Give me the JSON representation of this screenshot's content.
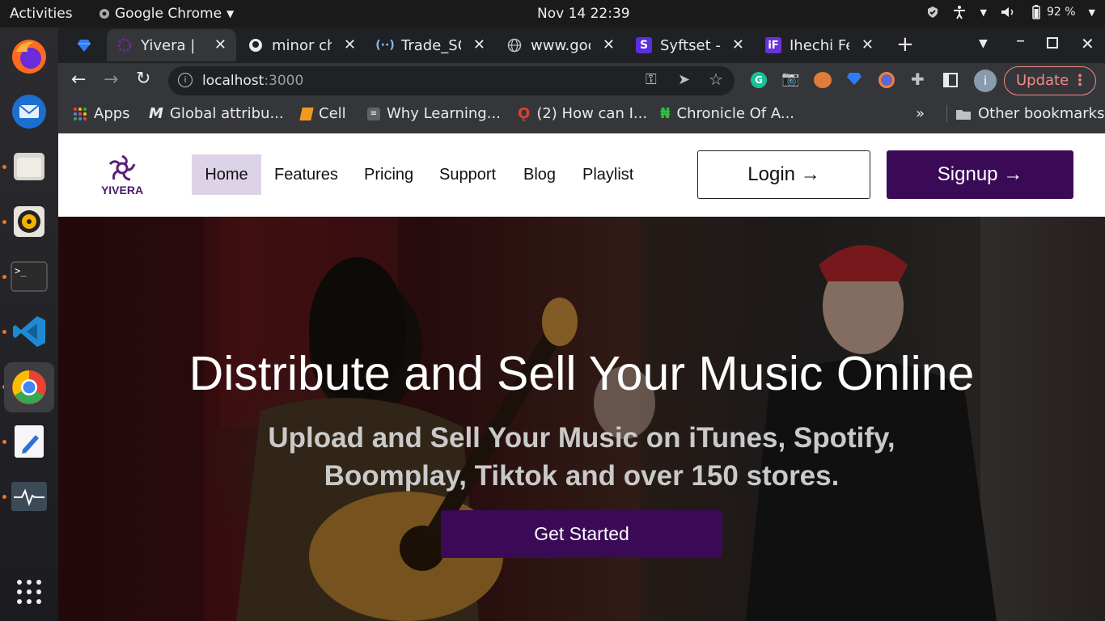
{
  "system": {
    "activities": "Activities",
    "app_name": "Google Chrome",
    "clock": "Nov 14  22:39",
    "battery": "92 %"
  },
  "tabs": [
    {
      "title": "",
      "icon": "gem-icon"
    },
    {
      "title": "Yivera | M",
      "icon": "yivera-icon"
    },
    {
      "title": "minor cha",
      "icon": "github-icon"
    },
    {
      "title": "Trade_SC",
      "icon": "code-icon"
    },
    {
      "title": "www.goo",
      "icon": "globe-icon"
    },
    {
      "title": "Syftset - F",
      "icon": "s-icon"
    },
    {
      "title": "Ihechi Fes",
      "icon": "if-icon"
    }
  ],
  "toolbar": {
    "url_host": "localhost",
    "url_port": ":3000",
    "update_label": "Update"
  },
  "bookmarks": {
    "items": [
      "Apps",
      "Global attribu...",
      "Cell",
      "Why Learning...",
      "(2) How can I...",
      "Chronicle Of A..."
    ],
    "more": "»",
    "other": "Other bookmarks"
  },
  "site": {
    "brand": "YIVERA",
    "nav": [
      "Home",
      "Features",
      "Pricing",
      "Support",
      "Blog",
      "Playlist"
    ],
    "login": "Login →",
    "signup": "Signup →",
    "hero_title": "Distribute and Sell Your Music Online",
    "hero_sub_1": "Upload and Sell Your Music on iTunes, Spotify,",
    "hero_sub_2": "Boomplay, Tiktok and over 150 stores.",
    "cta": "Get Started"
  },
  "colors": {
    "brand_purple": "#3b0a57",
    "nav_active_bg": "#ddd3e6",
    "update_red": "#f28b82"
  }
}
